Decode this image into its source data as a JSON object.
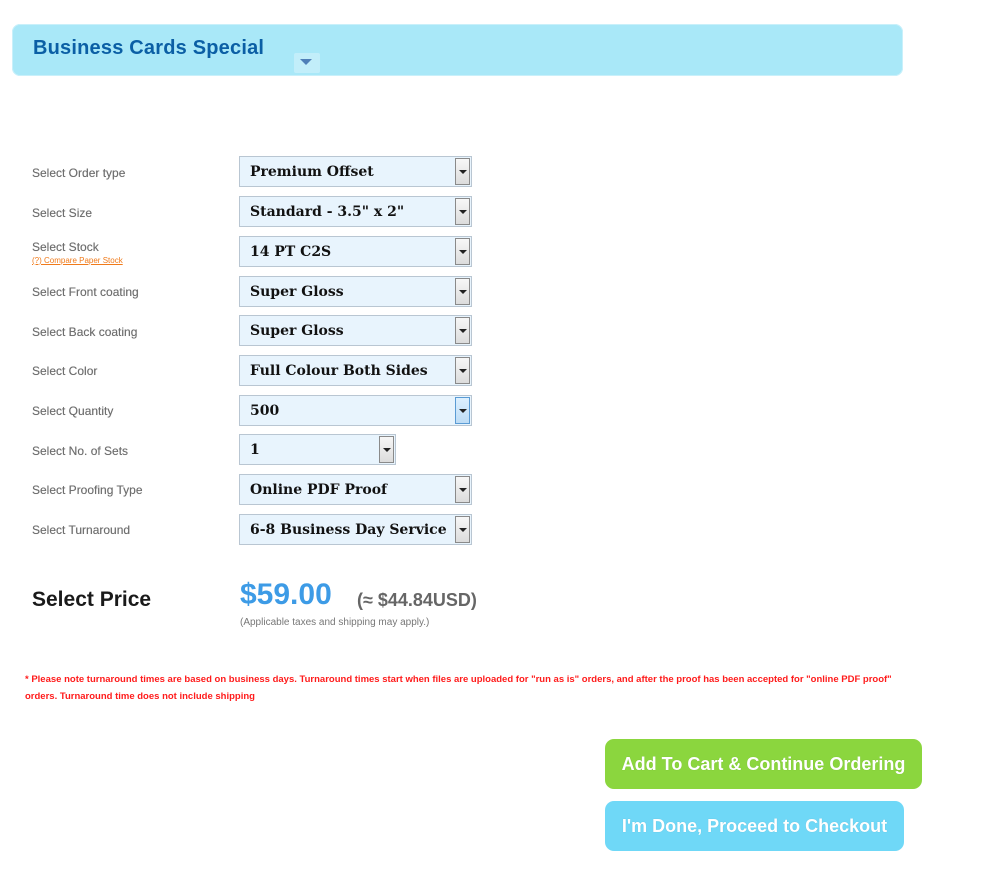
{
  "header": {
    "title": "Business Cards Special",
    "caret_icon": "chevron-down-icon"
  },
  "options": [
    {
      "label": "Select Order type",
      "value": "Premium Offset"
    },
    {
      "label": "Select Size",
      "value": "Standard - 3.5\" x 2\""
    },
    {
      "label": "Select Stock",
      "value": "14 PT C2S",
      "link": "(?) Compare Paper Stock"
    },
    {
      "label": "Select Front coating",
      "value": "Super Gloss"
    },
    {
      "label": "Select Back coating",
      "value": "Super Gloss"
    },
    {
      "label": "Select Color",
      "value": "Full Colour Both Sides"
    },
    {
      "label": "Select Quantity",
      "value": "500"
    },
    {
      "label": "Select No. of Sets",
      "value": "1"
    },
    {
      "label": "Select Proofing Type",
      "value": "Online PDF Proof"
    },
    {
      "label": "Select Turnaround",
      "value": "6-8 Business Day Service"
    }
  ],
  "price": {
    "label": "Select Price",
    "value": "$59.00",
    "usd": "(≈ $44.84USD)",
    "note": "(Applicable taxes and shipping may apply.)"
  },
  "notice": "* Please note turnaround times are based on business days. Turnaround times start when files are uploaded for \"run as is\" orders, and after the proof has been accepted for \"online PDF proof\" orders. Turnaround time does not include shipping",
  "buttons": {
    "add_to_cart": "Add To Cart & Continue Ordering",
    "checkout": "I'm Done, Proceed to Checkout"
  },
  "colors": {
    "header_bg": "#a9e8f8",
    "header_title": "#0b5fa5",
    "price": "#3d9be6",
    "notice": "#ff1b1b",
    "cart_button": "#8bd63e",
    "checkout_button": "#6fd8f7"
  }
}
